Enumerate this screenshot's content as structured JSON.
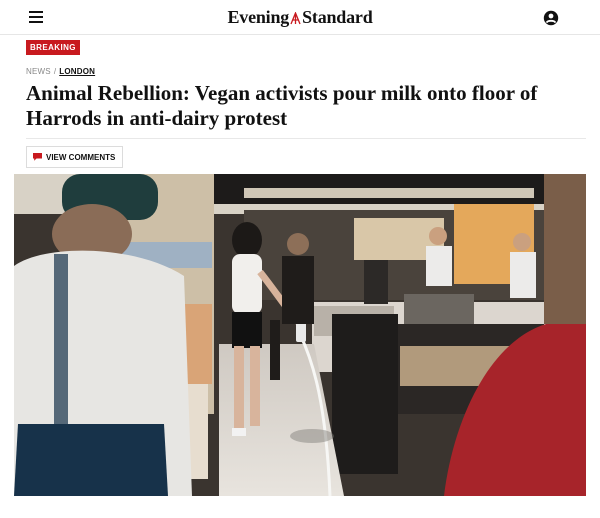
{
  "header": {
    "logo_left": "Evening",
    "logo_right": "Standard",
    "menu_icon": "hamburger-menu-icon",
    "account_icon": "account-icon"
  },
  "article": {
    "badge": "BREAKING",
    "breadcrumb": {
      "section": "NEWS",
      "separator": "/",
      "category": "LONDON"
    },
    "headline": "Animal Rebellion: Vegan activists pour milk onto floor of Harrods in anti-dairy protest",
    "comments_button": "VIEW COMMENTS",
    "comments_icon": "comment-bubble-icon"
  },
  "colors": {
    "accent_red": "#c81a1f",
    "text": "#111111"
  }
}
